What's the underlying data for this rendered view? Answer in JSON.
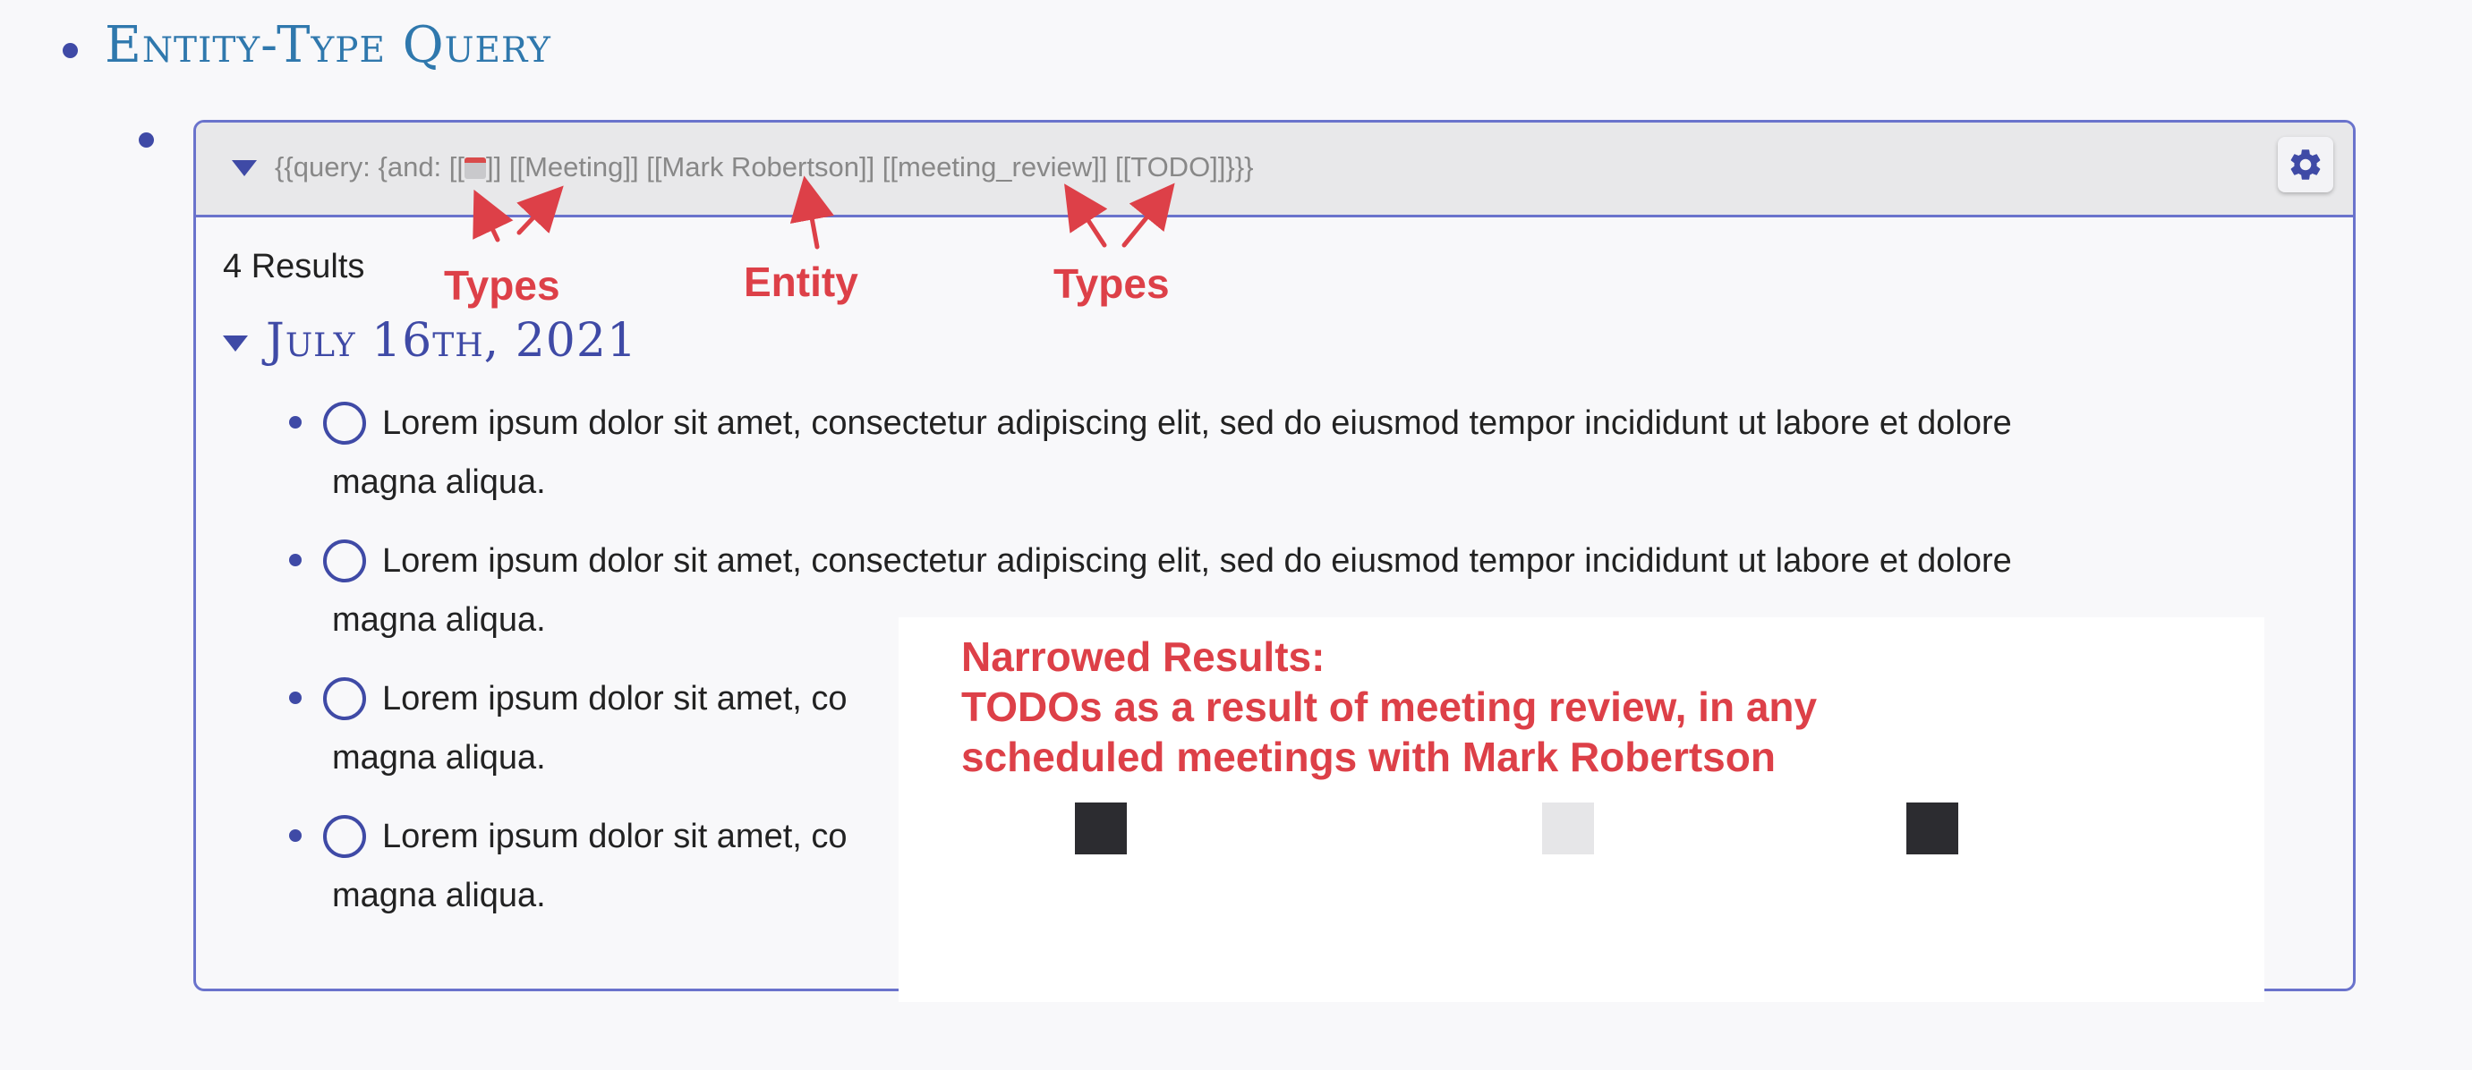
{
  "page": {
    "title": "Entity-Type Query"
  },
  "query": {
    "prefix": "{{query:  {and: [[",
    "suffix": "]] [[Meeting]] [[Mark Robertson]] [[meeting_review]] [[TODO]]}}}",
    "calendar_icon": "calendar-icon",
    "settings_icon": "gear-icon"
  },
  "results": {
    "count_label": "4 Results",
    "date": "July 16th, 2021",
    "items": [
      {
        "line1": "Lorem ipsum dolor sit amet, consectetur adipiscing elit, sed do eiusmod tempor incididunt ut labore et dolore",
        "line2": "magna aliqua."
      },
      {
        "line1": "Lorem ipsum dolor sit amet, consectetur adipiscing elit, sed do eiusmod tempor incididunt ut labore et dolore",
        "line2": "magna aliqua."
      },
      {
        "line1": "Lorem ipsum dolor sit amet, co",
        "line2": "magna aliqua."
      },
      {
        "line1": "Lorem ipsum dolor sit amet, co",
        "line2": "magna aliqua."
      }
    ]
  },
  "annotations": {
    "types_left": "Types",
    "entity": "Entity",
    "types_right": "Types",
    "narrowed_title": "Narrowed Results:",
    "narrowed_line1": "TODOs as a result of meeting review, in any",
    "narrowed_line2": "scheduled meetings with Mark Robertson"
  },
  "colors": {
    "accent": "#3f4aa6",
    "title": "#2f78ad",
    "annotation": "#dd4048",
    "border": "#6a73cc"
  }
}
